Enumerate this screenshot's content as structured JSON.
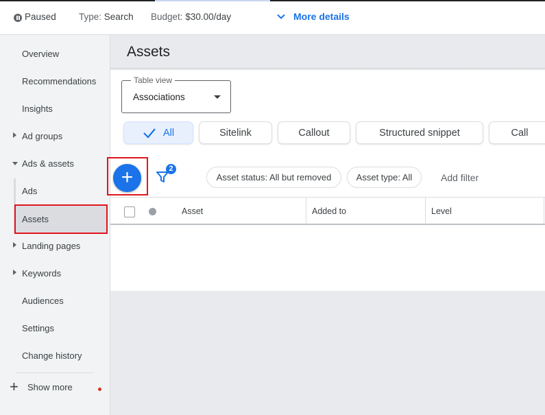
{
  "topbar": {
    "status": "Paused",
    "type_label": "Type:",
    "type_value": "Search",
    "budget_label": "Budget:",
    "budget_value": "$30.00/day",
    "more_details": "More details"
  },
  "sidebar": {
    "items": [
      {
        "label": "Overview"
      },
      {
        "label": "Recommendations"
      },
      {
        "label": "Insights"
      },
      {
        "label": "Ad groups"
      },
      {
        "label": "Ads & assets"
      },
      {
        "label": "Ads"
      },
      {
        "label": "Assets"
      },
      {
        "label": "Landing pages"
      },
      {
        "label": "Keywords"
      },
      {
        "label": "Audiences"
      },
      {
        "label": "Settings"
      },
      {
        "label": "Change history"
      }
    ],
    "show_more": "Show more"
  },
  "main": {
    "title": "Assets",
    "table_view": {
      "label": "Table view",
      "value": "Associations"
    },
    "chips": [
      {
        "label": "All",
        "selected": true
      },
      {
        "label": "Sitelink"
      },
      {
        "label": "Callout"
      },
      {
        "label": "Structured snippet"
      },
      {
        "label": "Call"
      }
    ],
    "filter_count": "2",
    "filters": [
      {
        "label": "Asset status: All but removed"
      },
      {
        "label": "Asset type: All"
      }
    ],
    "add_filter": "Add filter",
    "columns": [
      "Asset",
      "Added to",
      "Level"
    ]
  },
  "colors": {
    "accent": "#1a73e8",
    "highlight": "#e0141e",
    "sidebar_bg": "#f1f3f4"
  },
  "icons": [
    "pause-icon",
    "chevron-down-icon",
    "caret-right-icon",
    "caret-down-icon",
    "plus-icon",
    "filter-icon",
    "check-icon",
    "dropdown-arrow-icon"
  ]
}
